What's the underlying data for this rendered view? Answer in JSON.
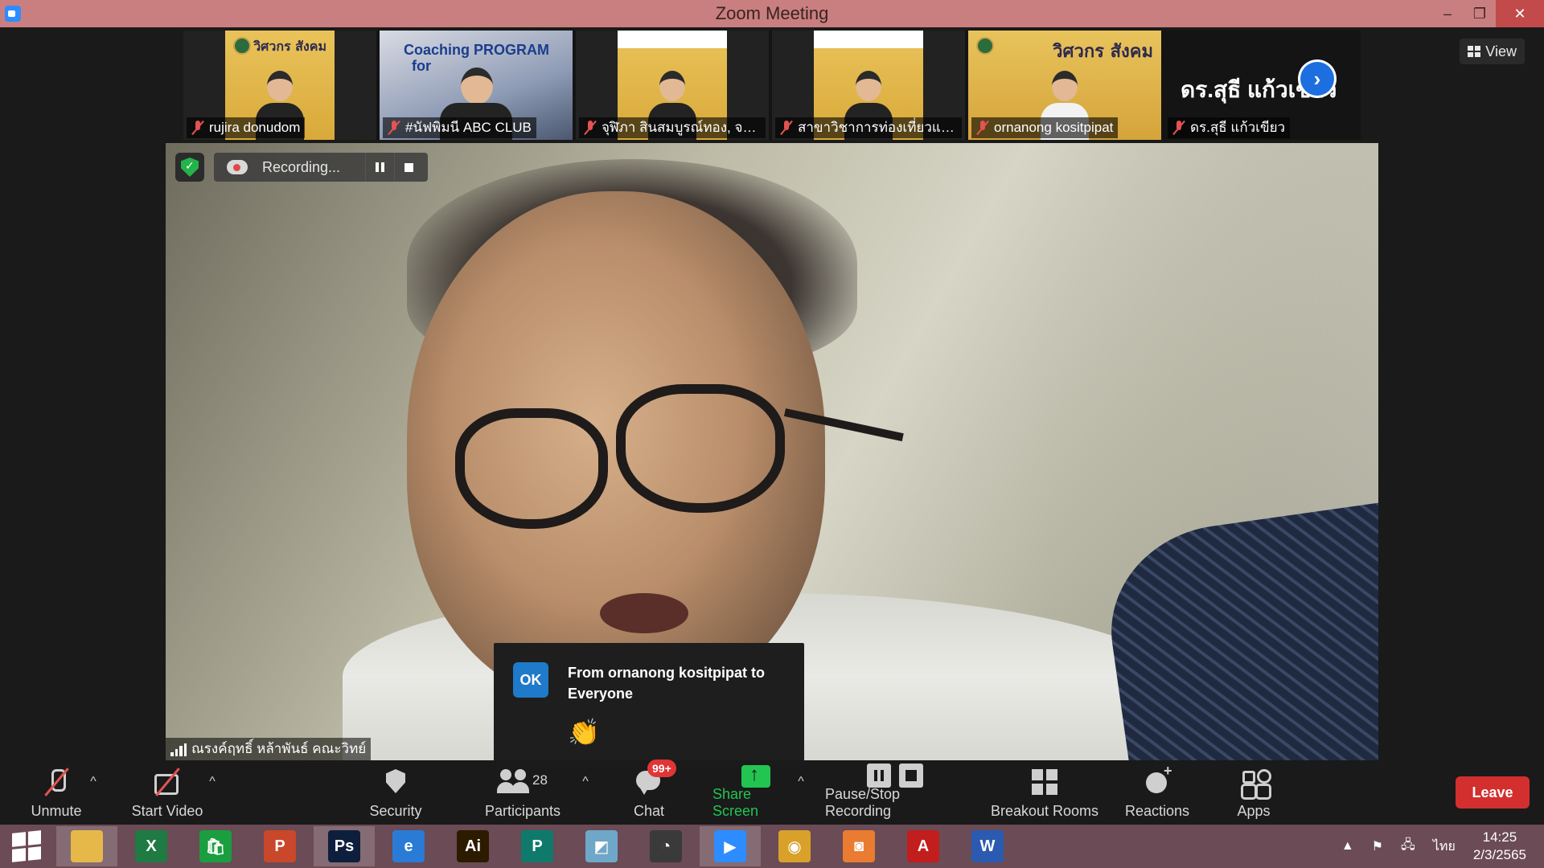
{
  "window": {
    "title": "Zoom Meeting",
    "controls": [
      "–",
      "❐",
      "✕"
    ]
  },
  "view_button": {
    "label": "View"
  },
  "participants_strip": [
    {
      "name": "rujira donudom",
      "muted": true,
      "style": "poster"
    },
    {
      "name": "#นัฟพิมนี ABC CLUB",
      "muted": true,
      "style": "coaching",
      "poster_text_1": "Coaching PROGRAM",
      "poster_text_2": "for"
    },
    {
      "name": "จุฬิภา สินสมบูรณ์ทอง, จจก.",
      "muted": true,
      "style": "poster-white"
    },
    {
      "name": "สาขาวิชาการท่องเที่ยวและก...",
      "muted": true,
      "style": "poster-white"
    },
    {
      "name": "ornanong kositpipat",
      "muted": true,
      "style": "poster-gold"
    },
    {
      "name": "ดร.สุธี แก้วเขียว",
      "muted": true,
      "style": "text-only",
      "big_name": "ดร.สุธี แก้วเขียว"
    }
  ],
  "poster_brand": "วิศวกร สังคม",
  "next_page_icon": "chevron-right-icon",
  "recording": {
    "label": "Recording...",
    "status_color": "#e04848"
  },
  "active_speaker": {
    "name": "ณรงค์ฤทธิ์ หล้าพันธ์ คณะวิทย์"
  },
  "chat_notification": {
    "avatar_initials": "OK",
    "from_text": "From ornanong kositpipat to Everyone",
    "message": "👏"
  },
  "toolbar": {
    "unmute": "Unmute",
    "start_video": "Start Video",
    "security": "Security",
    "participants": "Participants",
    "participants_count": "28",
    "chat": "Chat",
    "chat_badge": "99+",
    "share_screen": "Share Screen",
    "pause_stop_recording": "Pause/Stop Recording",
    "breakout_rooms": "Breakout Rooms",
    "reactions": "Reactions",
    "apps": "Apps",
    "leave": "Leave",
    "caret": "^"
  },
  "colors": {
    "title_bar": "#c97f7f",
    "share_green": "#23c552",
    "leave_red": "#d32f2f",
    "taskbar": "#6b4b55"
  },
  "taskbar": {
    "apps": [
      {
        "name": "file-explorer",
        "glyph": "",
        "color": "#e6b84a"
      },
      {
        "name": "excel",
        "glyph": "X",
        "color": "#1f7a43"
      },
      {
        "name": "store",
        "glyph": "🛍",
        "color": "#1a9e3f"
      },
      {
        "name": "powerpoint",
        "glyph": "P",
        "color": "#c9472b"
      },
      {
        "name": "photoshop",
        "glyph": "Ps",
        "color": "#0d1f3c"
      },
      {
        "name": "internet-explorer",
        "glyph": "e",
        "color": "#2a7bd6"
      },
      {
        "name": "illustrator",
        "glyph": "Ai",
        "color": "#2d1b00"
      },
      {
        "name": "publisher",
        "glyph": "P",
        "color": "#0f7a6b"
      },
      {
        "name": "notes",
        "glyph": "◩",
        "color": "#6fa7c9"
      },
      {
        "name": "photoscape",
        "glyph": "◔",
        "color": "#3a3a3a"
      },
      {
        "name": "zoom",
        "glyph": "▶",
        "color": "#2d8cff"
      },
      {
        "name": "chrome",
        "glyph": "◉",
        "color": "#d9a02a"
      },
      {
        "name": "photos",
        "glyph": "◙",
        "color": "#e97c30"
      },
      {
        "name": "acrobat",
        "glyph": "A",
        "color": "#c21e1e"
      },
      {
        "name": "word",
        "glyph": "W",
        "color": "#2b5bb0"
      }
    ],
    "tray": {
      "up_arrow": "▲",
      "lang": "ไทย",
      "time": "14:25",
      "date": "2/3/2565"
    }
  }
}
